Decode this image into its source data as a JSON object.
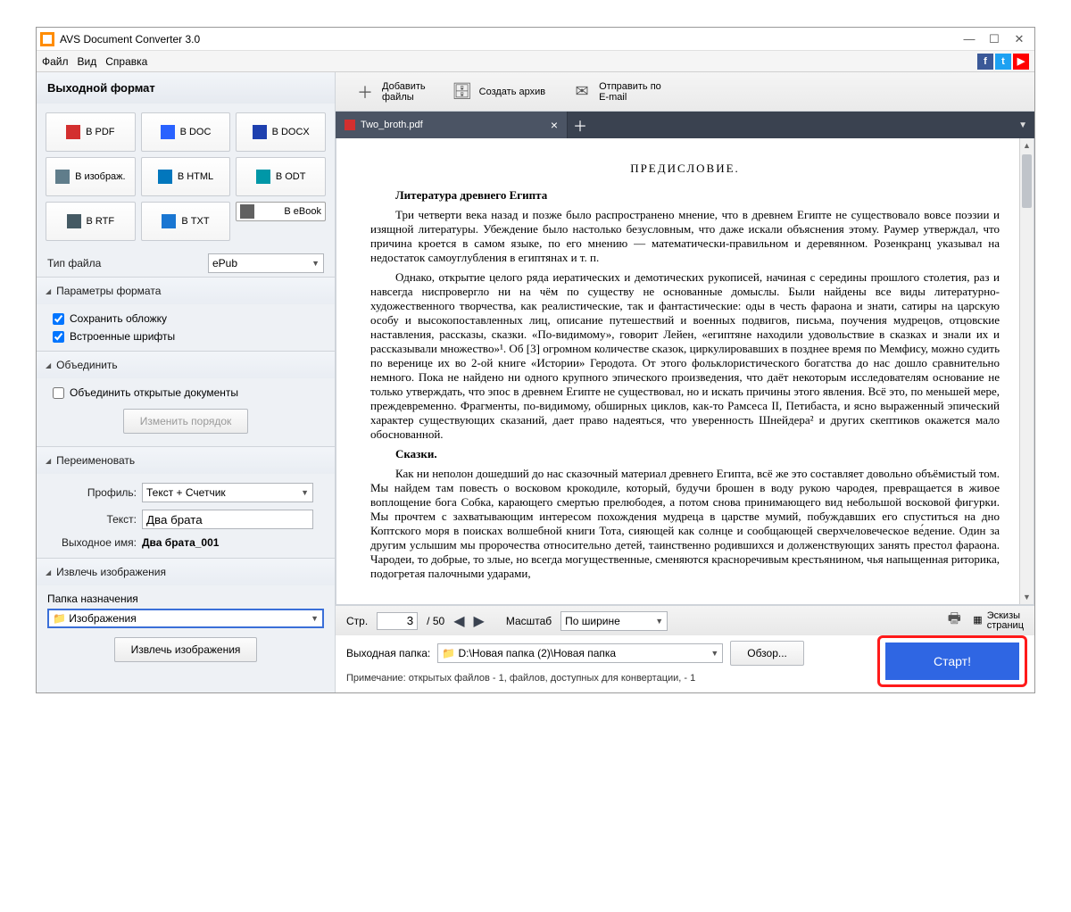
{
  "window": {
    "title": "AVS Document Converter 3.0"
  },
  "menu": {
    "file": "Файл",
    "view": "Вид",
    "help": "Справка"
  },
  "sidebar": {
    "title": "Выходной формат",
    "formats": [
      "В PDF",
      "В DOC",
      "В DOCX",
      "В изображ.",
      "В HTML",
      "В ODT",
      "В RTF",
      "В TXT",
      "В eBook"
    ],
    "file_type_label": "Тип файла",
    "file_type_value": "ePub",
    "section_format": "Параметры формата",
    "save_cover": "Сохранить обложку",
    "embedded_fonts": "Встроенные шрифты",
    "section_merge": "Объединить",
    "merge_open": "Объединить открытые документы",
    "change_order": "Изменить порядок",
    "section_rename": "Переименовать",
    "profile_label": "Профиль:",
    "profile_value": "Текст + Счетчик",
    "text_label": "Текст:",
    "text_value": "Два брата",
    "outname_label": "Выходное имя:",
    "outname_value": "Два брата_001",
    "section_extract": "Извлечь изображения",
    "dest_label": "Папка назначения",
    "dest_value": "Изображения",
    "extract_btn": "Извлечь изображения"
  },
  "topbar": {
    "add_files": "Добавить\nфайлы",
    "create_archive": "Создать архив",
    "send_email": "Отправить по\nE-mail"
  },
  "tab": {
    "name": "Two_broth.pdf"
  },
  "doc": {
    "title": "ПРЕДИСЛОВИЕ.",
    "h1": "Литература древнего Египта",
    "p1": "Три четверти века назад и позже было распространено мнение, что в древнем Египте не существовало вовсе поэзии и изящной литературы. Убеждение было настолько безусловным, что даже искали объяснения этому. Раумер утверждал, что причина кроется в самом языке, по его мнению — математически-правильном и деревянном. Розенкранц указывал на недостаток самоуглубления в египтянах и т. п.",
    "p2": "Однако, открытие целого ряда иератических и демотических рукописей, начиная с середины прошлого столетия, раз и навсегда ниспровергло ни на чём по существу не основанные домыслы. Были найдены все виды литературно-художественного творчества, как реалистические, так и фантастические: оды в честь фараона и знати, сатиры на царскую особу и высокопоставленных лиц, описание путешествий и военных подвигов, письма, поучения мудрецов, отцовские наставления, рассказы, сказки. «По-видимому», говорит Лейен, «египтяне находили удовольствие в сказках и знали их и рассказывали множество»¹. Об [3] огромном количестве сказок, циркулировавших в позднее время по Мемфису, можно судить по веренице их во 2-ой книге «Истории» Геродота. От этого фольклористического богатства до нас дошло сравнительно немного. Пока не найдено ни одного крупного эпического произведения, что даёт некоторым исследователям основание не только утверждать, что эпос в древнем Египте не существовал, но и искать причины этого явления. Всё это, по меньшей мере, преждевременно. Фрагменты, по-видимому, обширных циклов, как-то Рамсеса II, Петибаста, и ясно выраженный эпический характер существующих сказаний, дает право надеяться, что уверенность Шнейдера² и других скептиков окажется мало обоснованной.",
    "h2": "Сказки.",
    "p3": "Как ни неполон дошедший до нас сказочный материал древнего Египта, всё же это составляет довольно объёмистый том. Мы найдем там повесть о восковом крокодиле, который, будучи брошен в воду рукою чародея, превращается в живое воплощение бога Собка, карающего смертью прелюбодея, а потом снова принимающего вид небольшой восковой фигурки. Мы прочтем с захватывающим интересом похождения мудреца в царстве мумий, побуждавших его спуститься на дно Коптского моря в поисках волшебной книги Тота, сияющей как солнце и сообщающей сверхчеловеческое ве́дение. Один за другим услышим мы пророчества относительно детей, таинственно родившихся и долженствующих занять престол фараона. Чародеи, то добрые, то злые, но всегда могущественные, сменяются красноречивым крестьянином, чья напыщенная риторика, подогретая палочными ударами,"
  },
  "pager": {
    "page_label": "Стр.",
    "page": "3",
    "total": "/ 50",
    "zoom_label": "Масштаб",
    "zoom_value": "По ширине",
    "thumbs": "Эскизы\nстраниц"
  },
  "output": {
    "folder_label": "Выходная папка:",
    "folder_value": "D:\\Новая папка (2)\\Новая папка",
    "browse": "Обзор...",
    "note": "Примечание: открытых файлов - 1, файлов, доступных для конвертации, - 1",
    "start": "Старт!"
  }
}
